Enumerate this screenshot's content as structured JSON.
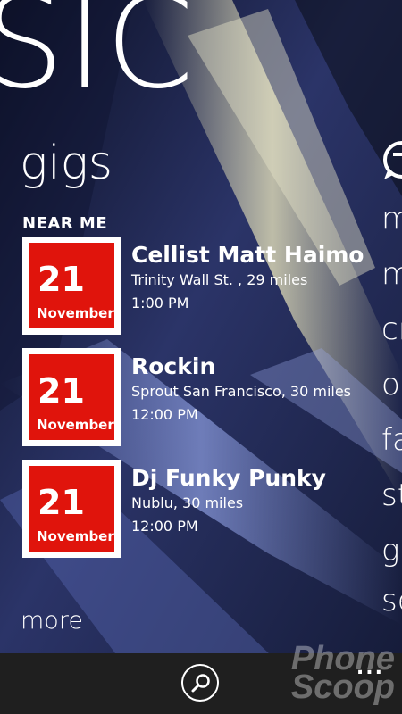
{
  "hub": {
    "title": "SIC"
  },
  "section": {
    "title": "gigs",
    "subheader": "NEAR ME"
  },
  "gigs": [
    {
      "day": "21",
      "month": "November",
      "title": "Cellist Matt Haimo",
      "venue": "Trinity Wall St. , 29 miles",
      "time": "1:00 PM"
    },
    {
      "day": "21",
      "month": "November",
      "title": "Rockin",
      "venue": "Sprout San Francisco, 30 miles",
      "time": "12:00 PM"
    },
    {
      "day": "21",
      "month": "November",
      "title": "Dj Funky Punky",
      "venue": "Nublu, 30 miles",
      "time": "12:00 PM"
    }
  ],
  "more_label": "more",
  "next_panel": {
    "icon": "speech-bubble-icon",
    "items": [
      "m",
      "m",
      "cr",
      "o",
      "fa",
      "st",
      "g",
      "se"
    ]
  },
  "app_bar": {
    "search_icon": "search-icon",
    "more_glyph": "..."
  },
  "watermark": {
    "line1": "Phone",
    "line2": "Scoop"
  },
  "colors": {
    "date_tile_red": "#e0140c",
    "app_bar": "#1f1f1f",
    "text": "#ffffff"
  }
}
